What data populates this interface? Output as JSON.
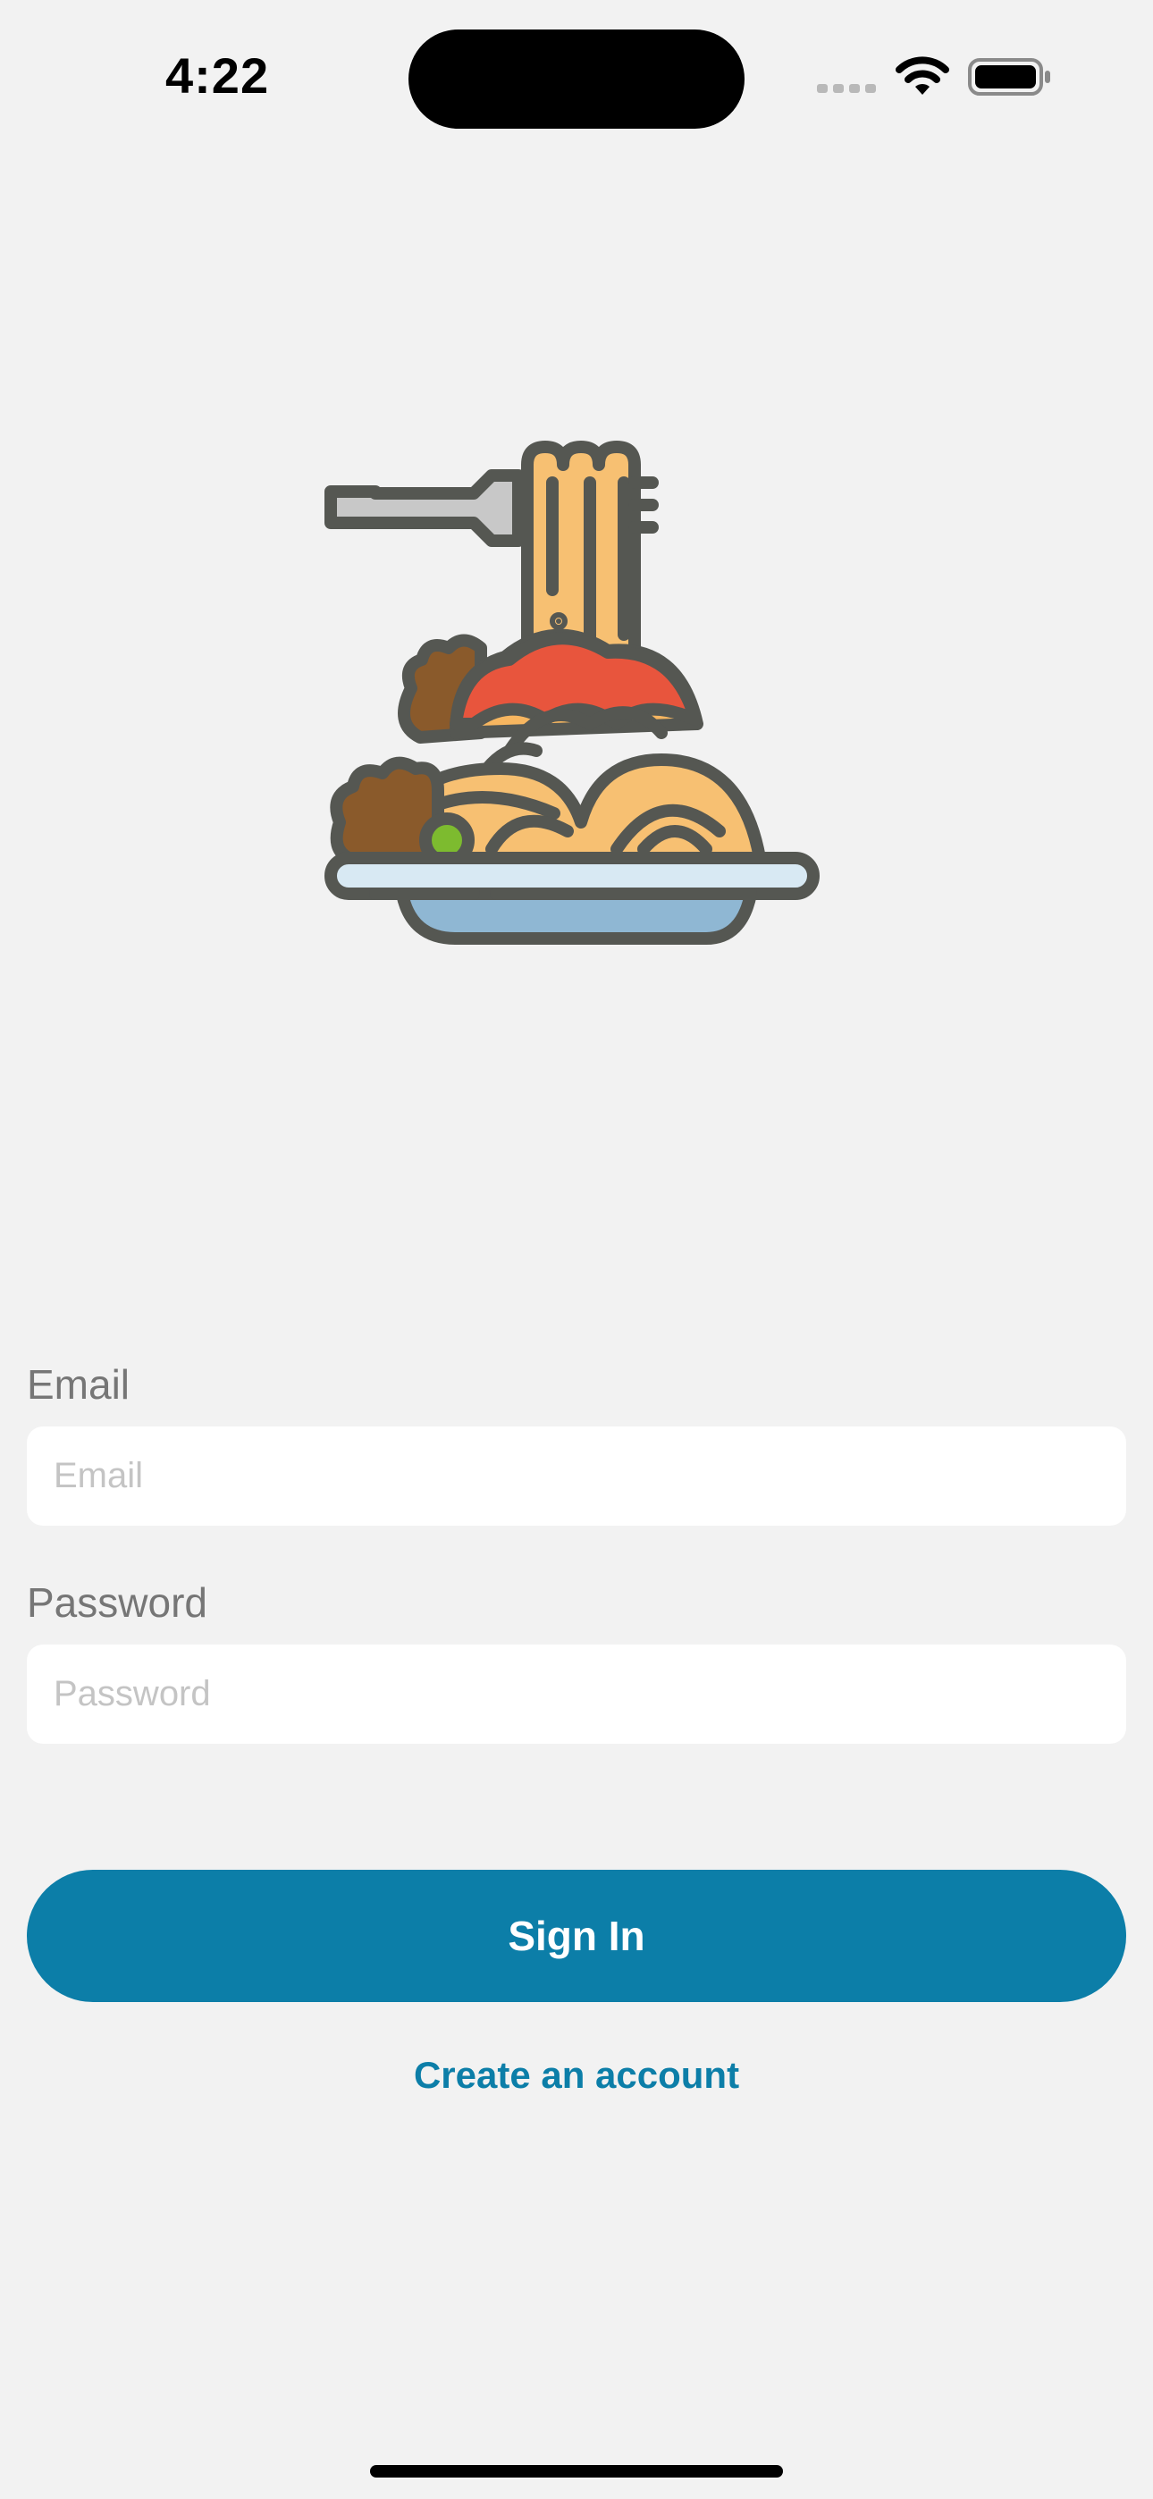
{
  "status_bar": {
    "time": "4:22",
    "icons": [
      "cellular-signal-icon",
      "wifi-icon",
      "battery-icon"
    ]
  },
  "hero": {
    "icon": "spaghetti-icon"
  },
  "form": {
    "email_label": "Email",
    "email_placeholder": "Email",
    "email_value": "",
    "password_label": "Password",
    "password_placeholder": "Password",
    "password_value": ""
  },
  "actions": {
    "sign_in_label": "Sign In",
    "create_account_label": "Create an account"
  },
  "colors": {
    "background": "#f2f2f2",
    "accent": "#0c7ea8",
    "label": "#767676",
    "placeholder": "#c4c4c4"
  }
}
